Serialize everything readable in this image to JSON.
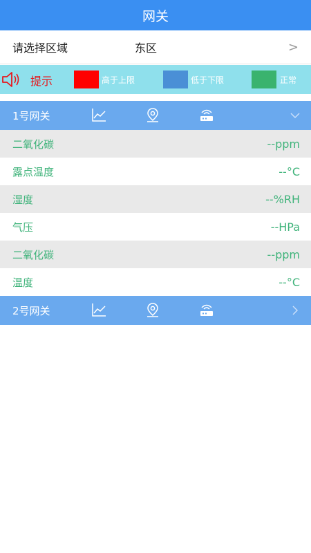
{
  "header": {
    "title": "网关"
  },
  "region": {
    "label": "请选择区域",
    "value": "东区",
    "chevron": ">"
  },
  "legend": {
    "tip": "提示",
    "items": [
      {
        "label": "高于上限",
        "color": "#ff0000"
      },
      {
        "label": "低于下限",
        "color": "#4a8fd6"
      },
      {
        "label": "正常",
        "color": "#3ab36e"
      }
    ]
  },
  "gateways": [
    {
      "name": "1号网关",
      "expand_icon": "chevron-down-icon",
      "readings": [
        {
          "name": "二氧化碳",
          "value": "--ppm"
        },
        {
          "name": "露点温度",
          "value": "--°C"
        },
        {
          "name": "湿度",
          "value": "--%RH"
        },
        {
          "name": "气压",
          "value": "--HPa"
        },
        {
          "name": "二氧化碳",
          "value": "--ppm"
        },
        {
          "name": "温度",
          "value": "--°C"
        }
      ]
    },
    {
      "name": "2号网关",
      "expand_icon": "chevron-right-icon",
      "readings": []
    }
  ],
  "icons": [
    "speaker-icon",
    "line-chart-icon",
    "location-pin-icon",
    "router-icon"
  ]
}
